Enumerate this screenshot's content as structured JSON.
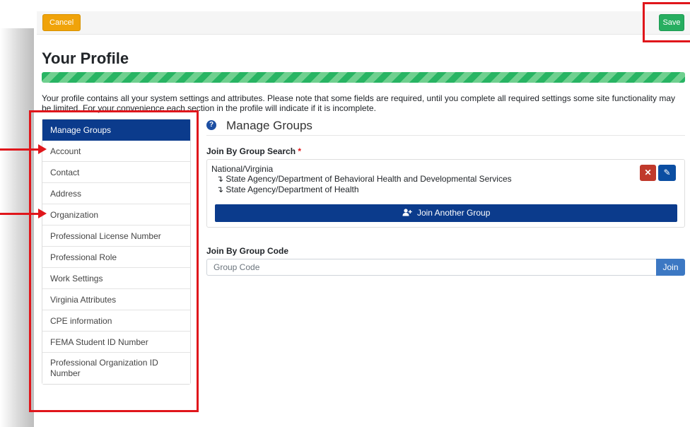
{
  "toolbar": {
    "cancel_label": "Cancel",
    "save_label": "Save"
  },
  "page": {
    "title": "Your Profile",
    "progress_percent": 100,
    "intro": "Your profile contains all your system settings and attributes. Please note that some fields are required, until you complete all required settings some site functionality may be limited. For your convenience each section in the profile will indicate if it is incomplete."
  },
  "sidebar": {
    "items": [
      {
        "label": "Manage Groups",
        "active": true
      },
      {
        "label": "Account"
      },
      {
        "label": "Contact"
      },
      {
        "label": "Address"
      },
      {
        "label": "Organization"
      },
      {
        "label": "Professional License Number"
      },
      {
        "label": "Professional Role"
      },
      {
        "label": "Work Settings"
      },
      {
        "label": "Virginia Attributes"
      },
      {
        "label": "CPE information"
      },
      {
        "label": "FEMA Student ID Number"
      },
      {
        "label": "Professional Organization ID Number"
      }
    ]
  },
  "main": {
    "section_title": "Manage Groups",
    "help_glyph": "?",
    "join_search_label": "Join By Group Search",
    "required_mark": "*",
    "group": {
      "root": "National/Virginia",
      "children": [
        "State Agency/Department of Behavioral Health and Developmental Services",
        "State Agency/Department of Health"
      ],
      "child_glyph": "↴"
    },
    "delete_glyph": "✕",
    "edit_glyph": "✎",
    "join_another_label": "Join Another Group",
    "join_code_label": "Join By Group Code",
    "code_placeholder": "Group Code",
    "join_label": "Join"
  },
  "colors": {
    "primary": "#0b3b8c",
    "success": "#27ae60",
    "warning": "#f0a30a",
    "danger": "#c0392b",
    "annotation": "#e0161b"
  },
  "icons": {
    "help": "question-circle-icon",
    "delete": "times-icon",
    "edit": "pencil-icon",
    "join_another": "user-plus-icon"
  }
}
